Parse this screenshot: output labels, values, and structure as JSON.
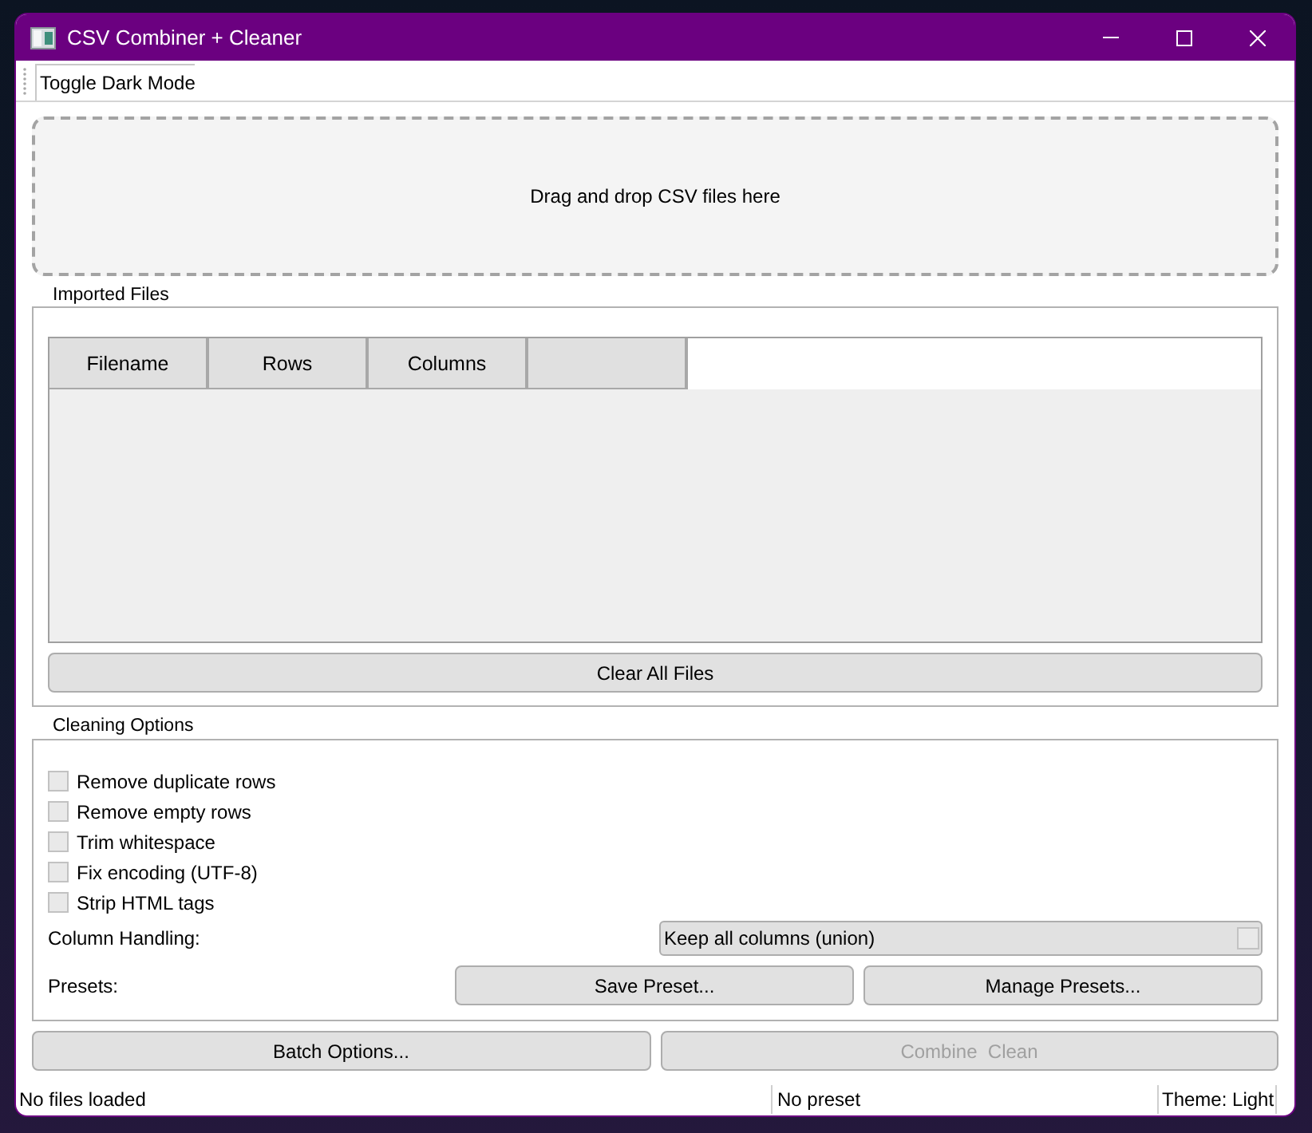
{
  "window": {
    "title": "CSV Combiner + Cleaner"
  },
  "toolbar": {
    "buttons": [
      {
        "label": "Toggle Dark Mode"
      }
    ]
  },
  "drop_zone": {
    "text": "Drag and drop CSV files here"
  },
  "imported_files": {
    "title": "Imported Files",
    "table": {
      "columns": [
        {
          "kind": "text",
          "label": "Filename"
        },
        {
          "kind": "text",
          "label": "Rows"
        },
        {
          "kind": "text",
          "label": "Columns"
        },
        {
          "kind": "blank"
        }
      ]
    },
    "clear_button": {
      "label": "Clear All Files"
    }
  },
  "cleaning_options": {
    "title": "Cleaning Options",
    "options": [
      {
        "label": "Remove duplicate rows",
        "checked": false
      },
      {
        "label": "Remove empty rows",
        "checked": false
      },
      {
        "label": "Trim whitespace",
        "checked": false
      },
      {
        "label": "Fix encoding (UTF-8)",
        "checked": false
      },
      {
        "label": "Strip HTML tags",
        "checked": false
      }
    ],
    "column_handling": {
      "label": "Column Handling:",
      "value": "Keep all columns (union)"
    },
    "presets": {
      "label": "Presets:",
      "buttons": [
        {
          "label": "Save Preset..."
        },
        {
          "label": "Manage Presets..."
        }
      ]
    }
  },
  "actions": [
    {
      "label": "Batch Options...",
      "disabled": false
    },
    {
      "label": "Combine  Clean",
      "disabled": true
    }
  ],
  "status_bar": [
    {
      "text": "No files loaded"
    },
    {
      "text": "No preset"
    },
    {
      "text": "Theme: Light"
    }
  ]
}
